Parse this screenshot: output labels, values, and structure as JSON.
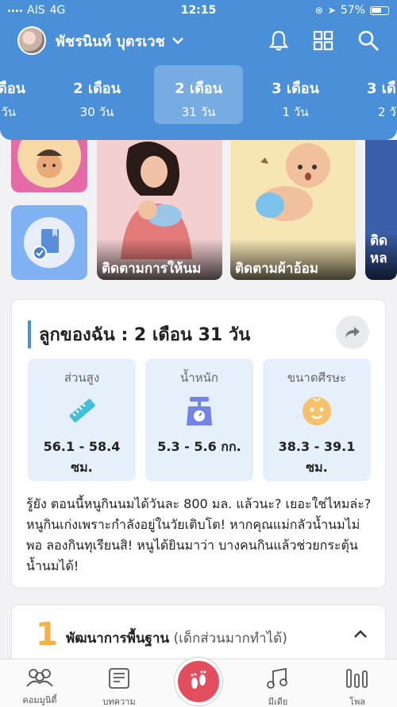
{
  "status_bar": {
    "carrier": "AIS",
    "network": "4G",
    "time": "12:15",
    "battery": "57%"
  },
  "header": {
    "profile_name": "พัชรนินท์ บุตรเวช",
    "icons": [
      "bell-icon",
      "grid-icon",
      "search-icon"
    ],
    "age_tabs": [
      {
        "line1": "เดือน",
        "line2": "วัน"
      },
      {
        "line1": "2 เดือน",
        "line2": "30 วัน"
      },
      {
        "line1": "2 เดือน",
        "line2": "31 วัน",
        "active": true
      },
      {
        "line1": "3 เดือน",
        "line2": "1 วัน"
      },
      {
        "line1": "3 เดื",
        "line2": "2 วั"
      }
    ]
  },
  "feature_cards": [
    {
      "label": "ติดตามการให้นม"
    },
    {
      "label": "ติดตามผ้าอ้อม"
    },
    {
      "label": "ติด หล"
    }
  ],
  "baby_panel": {
    "title": "ลูกของฉัน : 2  เดือน 31  วัน",
    "metrics": [
      {
        "label": "ส่วนสูง",
        "value_line1": "56.1 - 58.4",
        "value_line2": "ซม.",
        "icon": "ruler-icon"
      },
      {
        "label": "น้ำหนัก",
        "value_line1": "5.3 - 5.6 กก.",
        "value_line2": "",
        "icon": "scale-icon"
      },
      {
        "label": "ขนาดศีรษะ",
        "value_line1": "38.3 - 39.1",
        "value_line2": "ซม.",
        "icon": "baby-head-icon"
      }
    ],
    "text": "รู้ยัง ตอนนี้หนูกินนมได้วันละ 800 มล. แล้วนะ? เยอะใช่ไหมล่ะ? หนูกินเก่งเพราะกำลังอยู่ในวัยเติบโต! หากคุณแม่กลัวน้ำนมไม่พอ ลองกินทุเรียนสิ! หนูได้ยินมาว่า บางคนกินแล้วช่วยกระตุ้นน้ำนมได้!"
  },
  "development_panel": {
    "number": "1",
    "title": "พัฒนาการพื้นฐาน",
    "subtitle": "(เด็กส่วนมากทำได้)"
  },
  "bottom_nav": [
    {
      "label": "คอมมูนิตี้",
      "icon": "community-icon"
    },
    {
      "label": "บทความ",
      "icon": "article-icon"
    },
    {
      "label": "",
      "icon": "footprint-icon"
    },
    {
      "label": "มีเดีย",
      "icon": "music-icon"
    },
    {
      "label": "โพล",
      "icon": "poll-icon"
    }
  ],
  "colors": {
    "header_blue": "#4a90d9",
    "center_button": "#e24e5d",
    "metric_bg": "#e6f0fb",
    "accent_orange": "#f5b04a"
  }
}
